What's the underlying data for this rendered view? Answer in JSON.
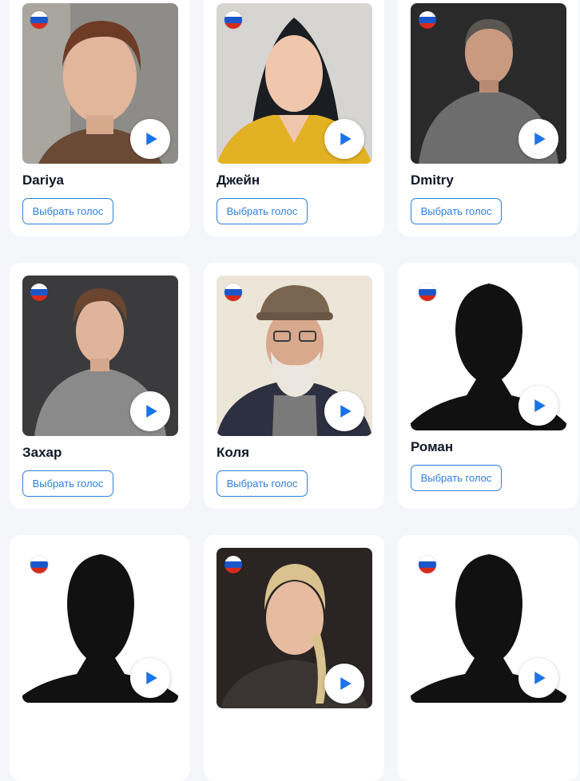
{
  "voice_cards": [
    {
      "name": "Dariya",
      "select_label": "Выбрать голос",
      "avatar": "woman-short-hair-photo",
      "flag": "russia-flag-icon"
    },
    {
      "name": "Джейн",
      "select_label": "Выбрать голос",
      "avatar": "woman-long-dark-hair-photo",
      "flag": "russia-flag-icon"
    },
    {
      "name": "Dmitry",
      "select_label": "Выбрать голос",
      "avatar": "man-gray-sweater-photo",
      "flag": "russia-flag-icon"
    },
    {
      "name": "Захар",
      "select_label": "Выбрать голос",
      "avatar": "young-man-gray-tshirt-photo",
      "flag": "russia-flag-icon"
    },
    {
      "name": "Коля",
      "select_label": "Выбрать голос",
      "avatar": "old-man-cap-beard-photo",
      "flag": "russia-flag-icon"
    },
    {
      "name": "Роман",
      "select_label": "Выбрать голос",
      "avatar": "male-silhouette",
      "flag": "russia-flag-icon"
    },
    {
      "name": "",
      "select_label": "",
      "avatar": "female-silhouette",
      "flag": "russia-flag-icon"
    },
    {
      "name": "",
      "select_label": "",
      "avatar": "woman-braided-hair-photo",
      "flag": "russia-flag-icon"
    },
    {
      "name": "",
      "select_label": "",
      "avatar": "female-silhouette",
      "flag": "russia-flag-icon"
    }
  ],
  "colors": {
    "page_bg": "#f4f6fa",
    "card_bg": "#ffffff",
    "accent": "#2d7fe0",
    "play_icon": "#1a73e8",
    "flag_white": "#ffffff",
    "flag_blue": "#1c57c9",
    "flag_red": "#d52b1e"
  }
}
